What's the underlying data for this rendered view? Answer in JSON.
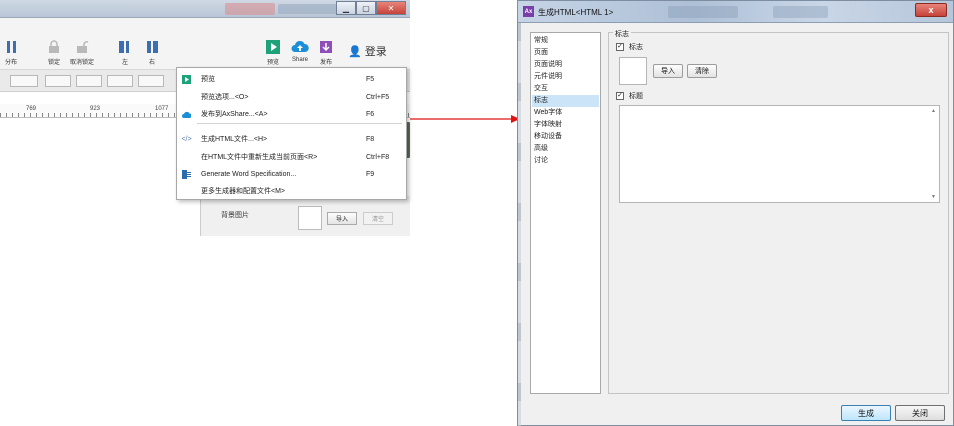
{
  "toolbar": {
    "buttons": [
      {
        "label": "分布"
      },
      {
        "label": "锁定"
      },
      {
        "label": "取消锁定"
      },
      {
        "label": "左"
      },
      {
        "label": "右"
      },
      {
        "label": "预览"
      },
      {
        "label": "Share"
      },
      {
        "label": "发布"
      }
    ],
    "login_label": "登录"
  },
  "ruler": {
    "marks": [
      "769",
      "923",
      "1077"
    ]
  },
  "inspector": {
    "bg_image_label": "背景图片",
    "import_label": "导入",
    "clear_label": "清空"
  },
  "publish_menu": {
    "items": [
      {
        "label": "预览",
        "shortcut": "F5",
        "icon": "play-icon"
      },
      {
        "label": "预览选项...<O>",
        "shortcut": "Ctrl+F5",
        "icon": ""
      },
      {
        "label": "发布到AxShare...<A>",
        "shortcut": "F6",
        "icon": "cloud-upload-icon"
      },
      {
        "label": "生成HTML文件...<H>",
        "shortcut": "F8",
        "icon": "code-icon"
      },
      {
        "label": "在HTML文件中重新生成当前页面<R>",
        "shortcut": "Ctrl+F8",
        "icon": ""
      },
      {
        "label": "Generate Word Specification...",
        "shortcut": "F9",
        "icon": "word-doc-icon"
      },
      {
        "label": "更多生成器和配置文件<M>",
        "shortcut": "",
        "icon": ""
      }
    ]
  },
  "dialog": {
    "title": "生成HTML<HTML 1>",
    "close_symbol": "x",
    "categories": [
      "常规",
      "页面",
      "页面说明",
      "元件说明",
      "交互",
      "标志",
      "Web字体",
      "字体映射",
      "移动设备",
      "高级",
      "讨论"
    ],
    "selected_category": "标志",
    "group_title": "标志",
    "logo_checkbox_label": "标志",
    "logo_checked": true,
    "import_label": "导入",
    "clear_label": "清除",
    "caption_checkbox_label": "标题",
    "caption_checked": true,
    "check_mark": "✓",
    "generate_label": "生成",
    "close_label": "关闭"
  },
  "colors": {
    "accent_red": "#e11414",
    "selection": "#cce4f7",
    "play_green": "#1fa27a",
    "cloud_blue": "#1a8fd8",
    "publish_purple": "#8e4fb8"
  }
}
